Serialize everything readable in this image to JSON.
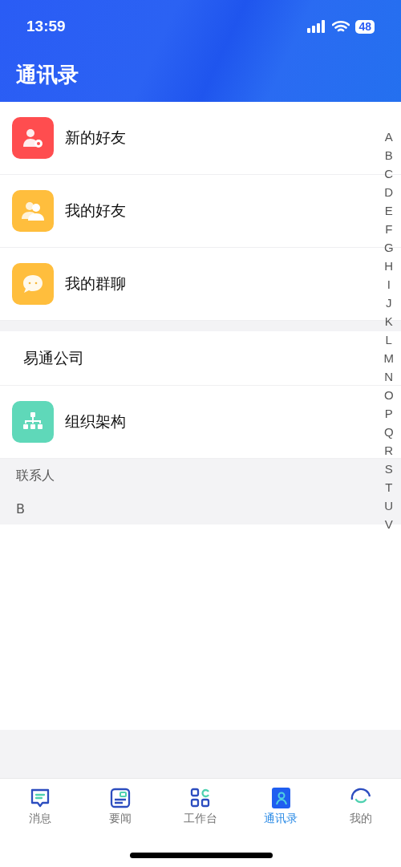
{
  "status_bar": {
    "time": "13:59",
    "battery": "48"
  },
  "header": {
    "title": "通讯录"
  },
  "entries": [
    {
      "kind": "icon",
      "label": "新的好友",
      "color": "#ff4d4f"
    },
    {
      "kind": "icon",
      "label": "我的好友",
      "color": "#ffbe3d"
    },
    {
      "kind": "icon",
      "label": "我的群聊",
      "color": "#ffbe3d"
    }
  ],
  "company": {
    "name": "易通公司",
    "items": [
      {
        "kind": "icon",
        "label": "组织架构",
        "color": "#5fd8b9"
      }
    ]
  },
  "contacts": {
    "title": "联系人",
    "groups": [
      {
        "letter": "B"
      }
    ]
  },
  "index_bar": [
    "A",
    "B",
    "C",
    "D",
    "E",
    "F",
    "G",
    "H",
    "I",
    "J",
    "K",
    "L",
    "M",
    "N",
    "O",
    "P",
    "Q",
    "R",
    "S",
    "T",
    "U",
    "V"
  ],
  "tab_bar": [
    {
      "label": "消息",
      "selected": false
    },
    {
      "label": "要闻",
      "selected": false
    },
    {
      "label": "工作台",
      "selected": false
    },
    {
      "label": "通讯录",
      "selected": true
    },
    {
      "label": "我的",
      "selected": false
    }
  ]
}
